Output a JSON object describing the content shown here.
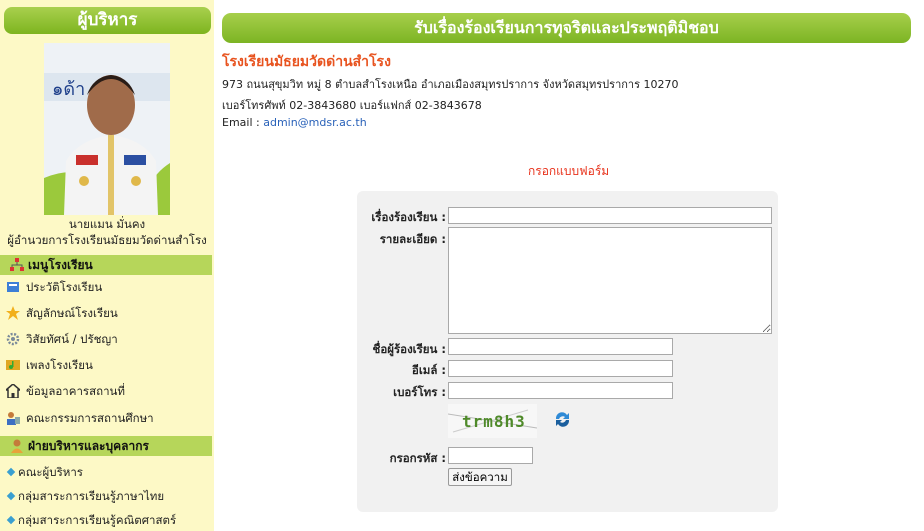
{
  "sidebar": {
    "header": "ผู้บริหาร",
    "photo_name": "นายแมน มั่นคง",
    "photo_title": "ผู้อำนวยการโรงเรียนมัธยมวัดด่านสำโรง",
    "photo_banner_text": "๑ด้า  าค",
    "menu1_title": "เมนูโรงเรียน",
    "menu1_items": [
      {
        "label": "ประวัติโรงเรียน",
        "icon": "history-icon"
      },
      {
        "label": "สัญลักษณ์โรงเรียน",
        "icon": "star-icon"
      },
      {
        "label": "วิสัยทัศน์ / ปรัชญา",
        "icon": "gear-icon"
      },
      {
        "label": "เพลงโรงเรียน",
        "icon": "music-icon"
      },
      {
        "label": "ข้อมูลอาคารสถานที่",
        "icon": "building-icon"
      },
      {
        "label": "คณะกรรมการสถานศึกษา",
        "icon": "committee-icon"
      }
    ],
    "menu2_title": "ฝ่ายบริหารและบุคลากร",
    "menu2_items": [
      {
        "label": "คณะผู้บริหาร"
      },
      {
        "label": "กลุ่มสาระการเรียนรู้ภาษาไทย"
      },
      {
        "label": "กลุ่มสาระการเรียนรู้คณิตศาสตร์"
      }
    ]
  },
  "main": {
    "header": "รับเรื่องร้องเรียนการทุจริตและประพฤติมิชอบ",
    "school_name": "โรงเรียนมัธยมวัดด่านสำโรง",
    "address": "973 ถนนสุขุมวิท หมู่ 8   ตำบลสำโรงเหนือ  อำเภอเมืองสมุทรปราการ  จังหวัดสมุทรปราการ  10270",
    "phone": "เบอร์โทรศัพท์ 02-3843680 เบอร์แฟกส์ 02-3843678",
    "email_label": "Email : ",
    "email": "admin@mdsr.ac.th"
  },
  "form": {
    "title": "กรอกแบบฟอร์ม",
    "subject_label": "เรื่องร้องเรียน :",
    "detail_label": "รายละเอียด :",
    "name_label": "ชื่อผู้ร้องเรียน :",
    "email_label": "อีเมล์ :",
    "phone_label": "เบอร์โทร :",
    "captcha_text": "trm8h3",
    "code_label": "กรอกรหัส :",
    "submit_label": "ส่งข้อความ"
  },
  "colors": {
    "accent_green": "#8bbf2e",
    "sidebar_bg": "#fdf9c6",
    "school_name": "#e8531f",
    "form_title": "#e8331c",
    "link": "#2a62b9"
  }
}
